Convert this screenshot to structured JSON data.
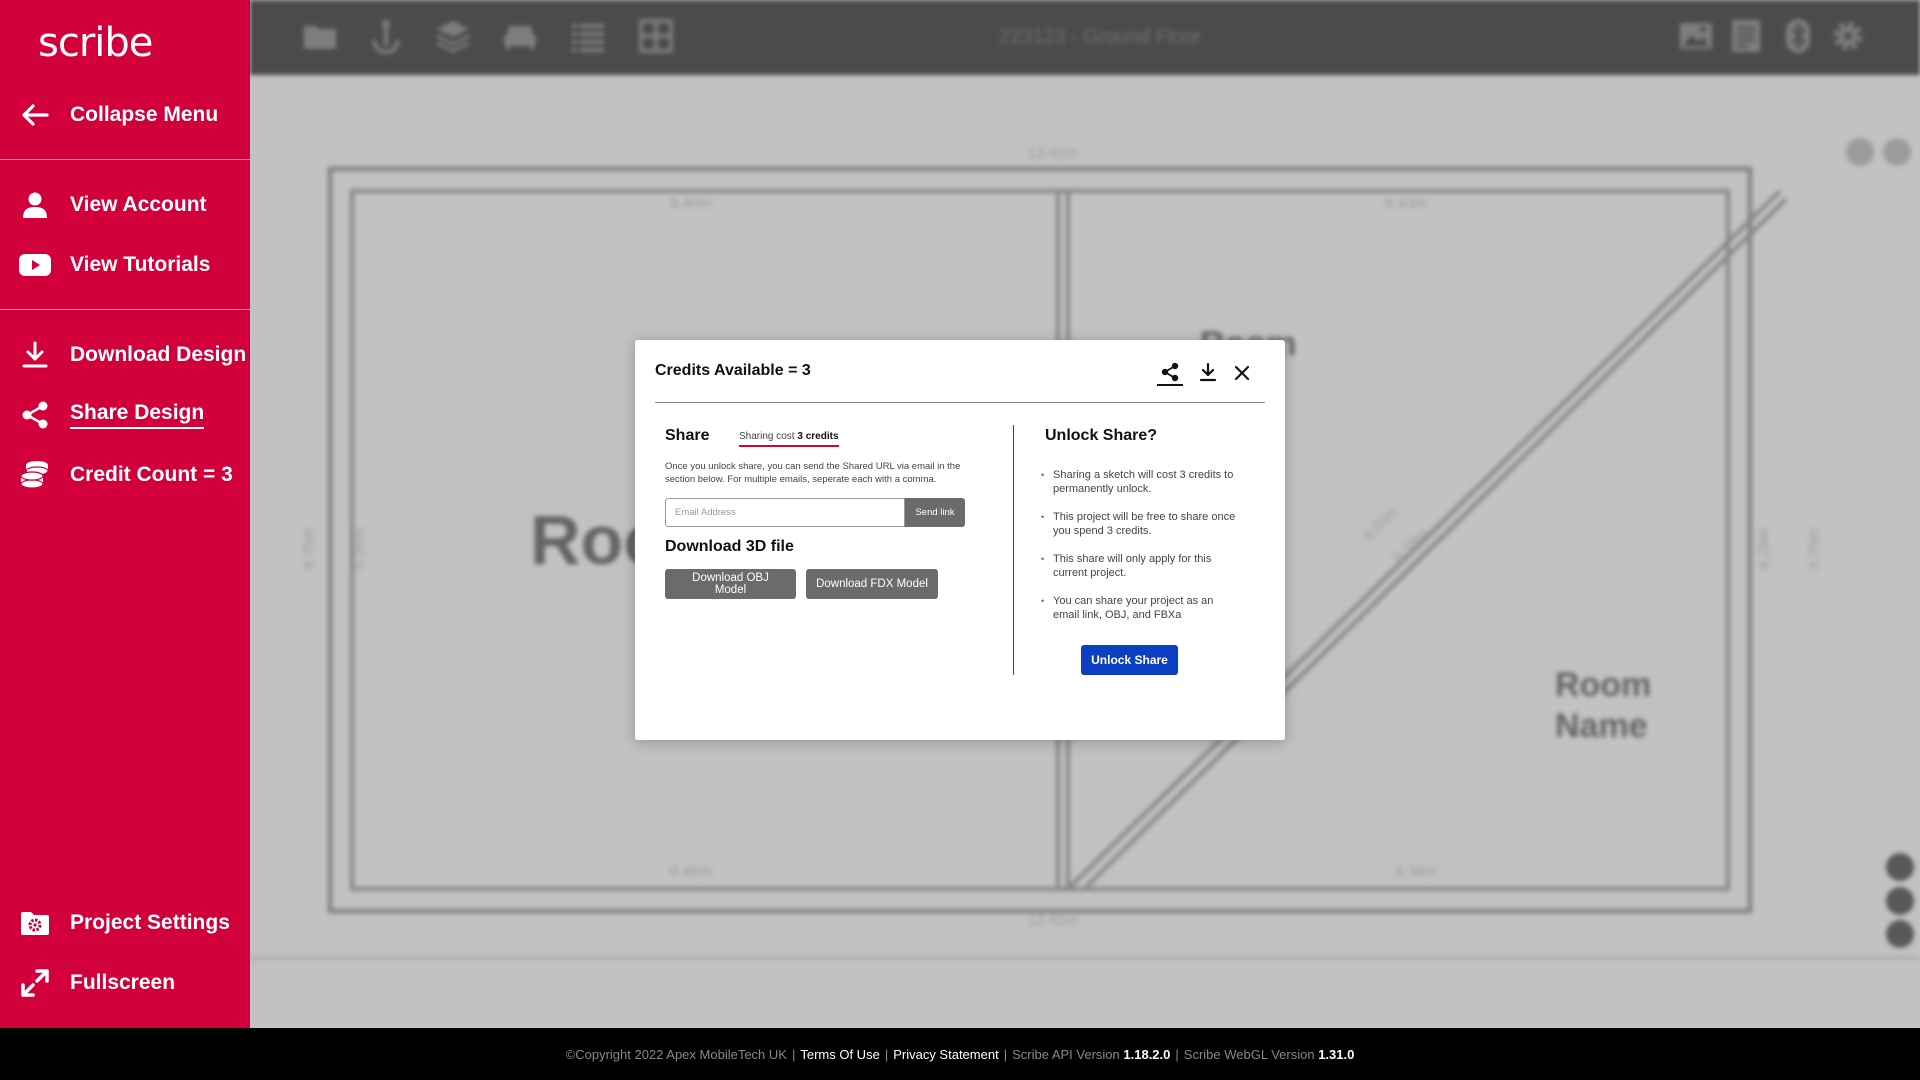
{
  "app": {
    "logo_text": "scribe"
  },
  "sidebar": {
    "collapse": "Collapse Menu",
    "view_account": "View Account",
    "view_tutorials": "View Tutorials",
    "download_design": "Download Design",
    "share_design": "Share Design",
    "credit_count": "Credit Count = 3",
    "project_settings": "Project Settings",
    "fullscreen": "Fullscreen"
  },
  "topbar": {
    "title": "223123 - Ground Floor"
  },
  "plan": {
    "room_left_partial": "Roo",
    "room_right_line1": "Room",
    "room_right_line2": "Name",
    "room_top_partial": "Room",
    "dims": {
      "top_outer": "13.41m",
      "top_left": "6.40m",
      "top_right": "6.43m",
      "bottom_left": "6.40m",
      "bottom_right": "6.38m",
      "bottom_outer": "13.41m",
      "left_outer": "6.75m",
      "left_inner": "6.36m",
      "right_inner": "6.28m",
      "right_outer": "6.75m",
      "diag1": "8.03m",
      "diag2": "8.58m"
    }
  },
  "modal": {
    "title": "Credits Available = 3",
    "share_heading": "Share",
    "share_cost_prefix": "Sharing cost",
    "share_cost_value": "3 credits",
    "share_description": "Once you unlock share, you can send the Shared URL via email in the section below. For multiple emails, seperate each with a comma.",
    "email_placeholder": "Email Address",
    "send_link": "Send link",
    "download3d_heading": "Download 3D file",
    "download_obj": "Download OBJ Model",
    "download_fdx": "Download FDX Model",
    "unlock_heading": "Unlock Share?",
    "unlock_points": [
      "Sharing a sketch will cost 3 credits to permanently unlock.",
      "This project will be free to share once you spend 3 credits.",
      "This share will only apply for this current project.",
      "You can share your project as an email link, OBJ, and FBXa"
    ],
    "unlock_button": "Unlock Share"
  },
  "footer": {
    "copyright": "©Copyright 2022 Apex MobileTech UK",
    "terms": "Terms Of Use",
    "privacy": "Privacy Statement",
    "api_label": "Scribe API Version",
    "api_version": "1.18.2.0",
    "webgl_label": "Scribe WebGL Version",
    "webgl_version": "1.31.0"
  },
  "colors": {
    "brand_red": "#d1003a",
    "unlock_blue": "#0a3fc2",
    "button_grey": "#6b6b6b"
  },
  "icons": {
    "sidebar": [
      "arrow-left-icon",
      "user-icon",
      "youtube-icon",
      "download-icon",
      "share-icon",
      "coins-icon",
      "folder-gear-icon",
      "expand-icon"
    ],
    "topbar": [
      "folder-icon",
      "anchor-icon",
      "layers-icon",
      "sofa-icon",
      "list-icon",
      "grid-icon",
      "image-icon",
      "notes-icon",
      "bluetooth-icon",
      "gear-icon"
    ]
  }
}
